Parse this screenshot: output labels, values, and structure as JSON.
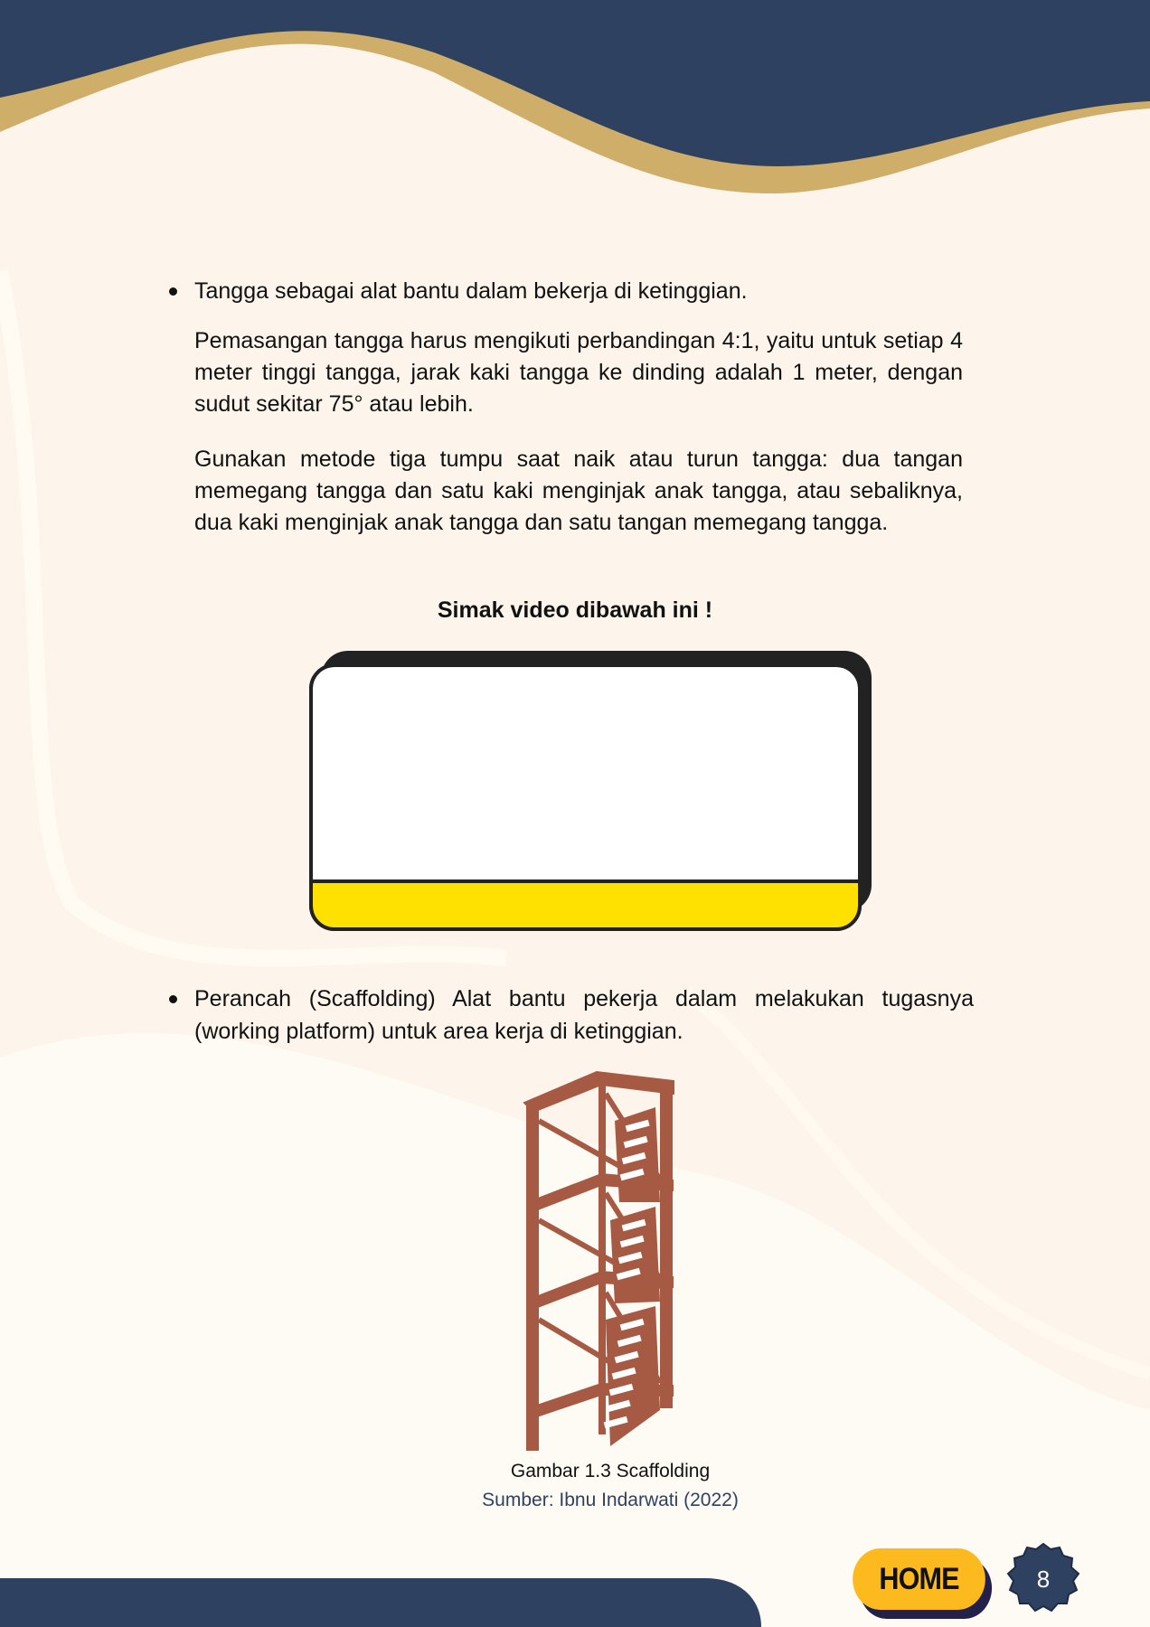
{
  "bullets": {
    "ladder": "Tangga sebagai alat bantu dalam bekerja di ketinggian.",
    "ladder_para1": "Pemasangan tangga harus mengikuti perbandingan 4:1, yaitu untuk setiap 4 meter tinggi tangga, jarak kaki tangga ke dinding adalah 1 meter, dengan sudut sekitar 75° atau lebih.",
    "ladder_para2": "Gunakan metode tiga tumpu saat naik atau turun tangga: dua tangan memegang tangga dan satu kaki menginjak anak tangga, atau sebaliknya, dua kaki menginjak anak tangga dan satu tangan memegang tangga.",
    "scaffolding": "Perancah (Scaffolding) Alat bantu pekerja dalam melakukan tugasnya (working platform) untuk area kerja di ketinggian."
  },
  "video": {
    "heading": "Simak video dibawah ini !"
  },
  "figure": {
    "caption": "Gambar 1.3 Scaffolding",
    "source": "Sumber: Ibnu Indarwati (2022)"
  },
  "footer": {
    "home_label": "HOME",
    "page_number": "8"
  },
  "colors": {
    "navy": "#2f4160",
    "gold": "#cfae6a",
    "cream": "#fdf5ec",
    "home_button": "#fdba1f",
    "video_yellow": "#ffe100",
    "scaffold": "#a65a43"
  }
}
